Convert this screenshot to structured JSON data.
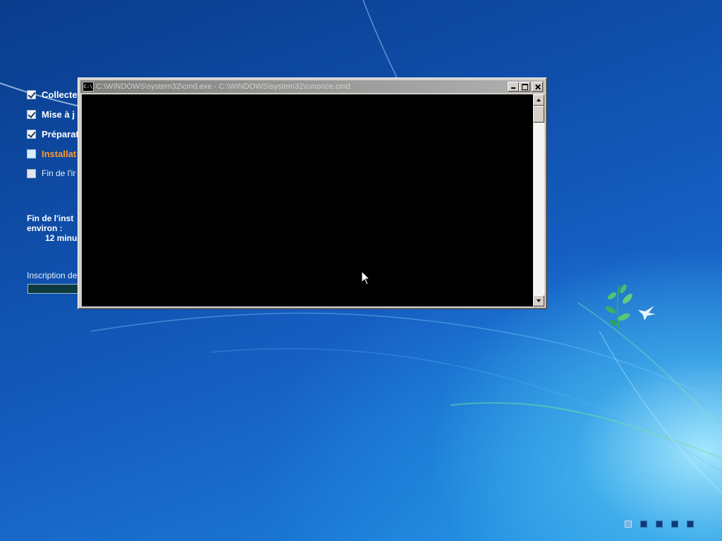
{
  "setup": {
    "tasks": [
      {
        "label": "Collecte",
        "status": "done"
      },
      {
        "label": "Mise à j",
        "status": "done"
      },
      {
        "label": "Préparat",
        "status": "done"
      },
      {
        "label": "Installat",
        "status": "current"
      },
      {
        "label": "Fin de l'ir",
        "status": "pending"
      }
    ],
    "time_remaining_line1": "Fin de l'inst",
    "time_remaining_line2": "environ :",
    "time_remaining_value": "12 minu",
    "registration_label": "Inscription de",
    "progress_fraction": 0.0
  },
  "cmd_window": {
    "title": "C:\\WINDOWS\\system32\\cmd.exe - C:\\WINDOWS\\system32\\runonce.cmd",
    "icon_text": "C:\\",
    "icon": "cmd-app-icon",
    "controls": [
      "minimize",
      "maximize",
      "close"
    ],
    "console_text": ""
  },
  "boot_indicator_count": 5,
  "colors": {
    "current_task": "#ff9a2e",
    "console_bg": "#000000",
    "inactive_title_start": "#808080",
    "inactive_title_end": "#b0b0b0"
  }
}
